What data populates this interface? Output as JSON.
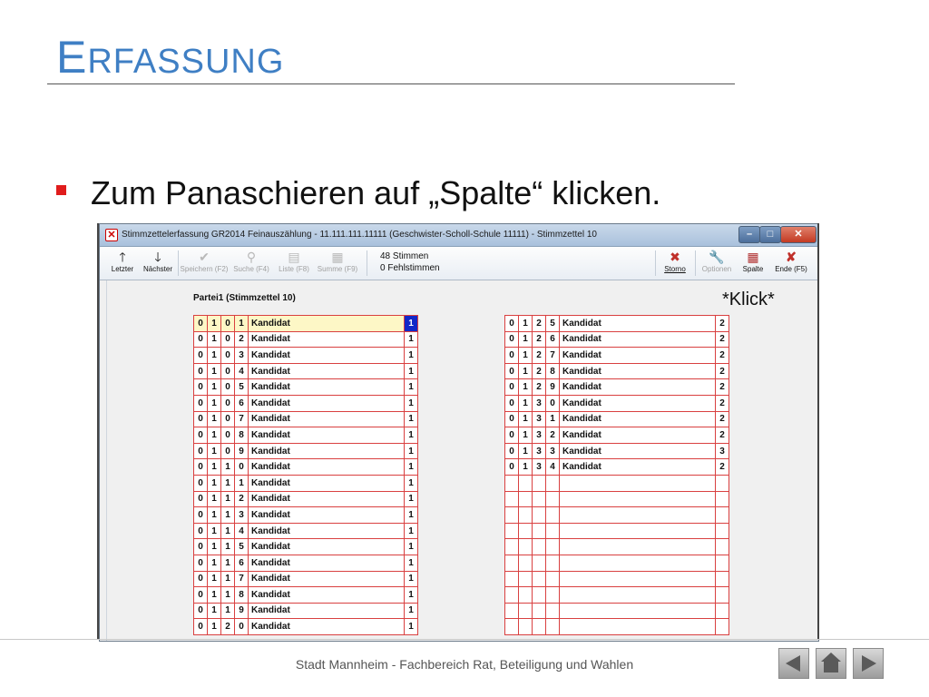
{
  "slide": {
    "title_initial": "E",
    "title_rest": "RFASSUNG",
    "bullet": "Zum Panaschieren auf „Spalte“ klicken."
  },
  "window": {
    "title": "Stimmzettelerfassung GR2014 Feinauszählung  -  11.111.111.11111   (Geschwister-Scholl-Schule 11111)  -   Stimmzettel 10",
    "toolbar": {
      "letzter": "Letzter",
      "naechster": "Nächster",
      "speichern": "Speichern (F2)",
      "suche": "Suche (F4)",
      "liste": "Liste (F8)",
      "summe": "Summe (F9)",
      "stimmen": "48 Stimmen",
      "fehlstimmen": "0 Fehlstimmen",
      "storno": "Storno",
      "optionen": "Optionen",
      "spalte": "Spalte",
      "ende": "Ende (F5)"
    },
    "partei_label": "Partei1 (Stimmzettel 10)",
    "annotation": "*Klick*",
    "left_rows": [
      {
        "d": [
          "0",
          "1",
          "0",
          "1"
        ],
        "name": "Kandidat",
        "v": "1"
      },
      {
        "d": [
          "0",
          "1",
          "0",
          "2"
        ],
        "name": "Kandidat",
        "v": "1"
      },
      {
        "d": [
          "0",
          "1",
          "0",
          "3"
        ],
        "name": "Kandidat",
        "v": "1"
      },
      {
        "d": [
          "0",
          "1",
          "0",
          "4"
        ],
        "name": "Kandidat",
        "v": "1"
      },
      {
        "d": [
          "0",
          "1",
          "0",
          "5"
        ],
        "name": "Kandidat",
        "v": "1"
      },
      {
        "d": [
          "0",
          "1",
          "0",
          "6"
        ],
        "name": "Kandidat",
        "v": "1"
      },
      {
        "d": [
          "0",
          "1",
          "0",
          "7"
        ],
        "name": "Kandidat",
        "v": "1"
      },
      {
        "d": [
          "0",
          "1",
          "0",
          "8"
        ],
        "name": "Kandidat",
        "v": "1"
      },
      {
        "d": [
          "0",
          "1",
          "0",
          "9"
        ],
        "name": "Kandidat",
        "v": "1"
      },
      {
        "d": [
          "0",
          "1",
          "1",
          "0"
        ],
        "name": "Kandidat",
        "v": "1"
      },
      {
        "d": [
          "0",
          "1",
          "1",
          "1"
        ],
        "name": "Kandidat",
        "v": "1"
      },
      {
        "d": [
          "0",
          "1",
          "1",
          "2"
        ],
        "name": "Kandidat",
        "v": "1"
      },
      {
        "d": [
          "0",
          "1",
          "1",
          "3"
        ],
        "name": "Kandidat",
        "v": "1"
      },
      {
        "d": [
          "0",
          "1",
          "1",
          "4"
        ],
        "name": "Kandidat",
        "v": "1"
      },
      {
        "d": [
          "0",
          "1",
          "1",
          "5"
        ],
        "name": "Kandidat",
        "v": "1"
      },
      {
        "d": [
          "0",
          "1",
          "1",
          "6"
        ],
        "name": "Kandidat",
        "v": "1"
      },
      {
        "d": [
          "0",
          "1",
          "1",
          "7"
        ],
        "name": "Kandidat",
        "v": "1"
      },
      {
        "d": [
          "0",
          "1",
          "1",
          "8"
        ],
        "name": "Kandidat",
        "v": "1"
      },
      {
        "d": [
          "0",
          "1",
          "1",
          "9"
        ],
        "name": "Kandidat",
        "v": "1"
      },
      {
        "d": [
          "0",
          "1",
          "2",
          "0"
        ],
        "name": "Kandidat",
        "v": "1"
      }
    ],
    "right_rows": [
      {
        "d": [
          "0",
          "1",
          "2",
          "5"
        ],
        "name": "Kandidat",
        "v": "2"
      },
      {
        "d": [
          "0",
          "1",
          "2",
          "6"
        ],
        "name": "Kandidat",
        "v": "2"
      },
      {
        "d": [
          "0",
          "1",
          "2",
          "7"
        ],
        "name": "Kandidat",
        "v": "2"
      },
      {
        "d": [
          "0",
          "1",
          "2",
          "8"
        ],
        "name": "Kandidat",
        "v": "2"
      },
      {
        "d": [
          "0",
          "1",
          "2",
          "9"
        ],
        "name": "Kandidat",
        "v": "2"
      },
      {
        "d": [
          "0",
          "1",
          "3",
          "0"
        ],
        "name": "Kandidat",
        "v": "2"
      },
      {
        "d": [
          "0",
          "1",
          "3",
          "1"
        ],
        "name": "Kandidat",
        "v": "2"
      },
      {
        "d": [
          "0",
          "1",
          "3",
          "2"
        ],
        "name": "Kandidat",
        "v": "2"
      },
      {
        "d": [
          "0",
          "1",
          "3",
          "3"
        ],
        "name": "Kandidat",
        "v": "3"
      },
      {
        "d": [
          "0",
          "1",
          "3",
          "4"
        ],
        "name": "Kandidat",
        "v": "2"
      },
      {
        "d": [
          "",
          "",
          "",
          ""
        ],
        "name": "",
        "v": ""
      },
      {
        "d": [
          "",
          "",
          "",
          ""
        ],
        "name": "",
        "v": ""
      },
      {
        "d": [
          "",
          "",
          "",
          ""
        ],
        "name": "",
        "v": ""
      },
      {
        "d": [
          "",
          "",
          "",
          ""
        ],
        "name": "",
        "v": ""
      },
      {
        "d": [
          "",
          "",
          "",
          ""
        ],
        "name": "",
        "v": ""
      },
      {
        "d": [
          "",
          "",
          "",
          ""
        ],
        "name": "",
        "v": ""
      },
      {
        "d": [
          "",
          "",
          "",
          ""
        ],
        "name": "",
        "v": ""
      },
      {
        "d": [
          "",
          "",
          "",
          ""
        ],
        "name": "",
        "v": ""
      },
      {
        "d": [
          "",
          "",
          "",
          ""
        ],
        "name": "",
        "v": ""
      },
      {
        "d": [
          "",
          "",
          "",
          ""
        ],
        "name": "",
        "v": ""
      }
    ]
  },
  "footer": {
    "text": "Stadt Mannheim - Fachbereich Rat, Beteiligung und Wahlen"
  },
  "colors": {
    "title_blue": "#3f7fc4",
    "bullet_red": "#e01c1c",
    "grid_red": "#d94040",
    "selected_cell_blue": "#1228c8",
    "selected_row_yellow": "#fdf7c6"
  },
  "icons": {
    "prev_slide": "triangle-left-icon",
    "home": "home-icon",
    "next_slide": "triangle-right-icon"
  }
}
